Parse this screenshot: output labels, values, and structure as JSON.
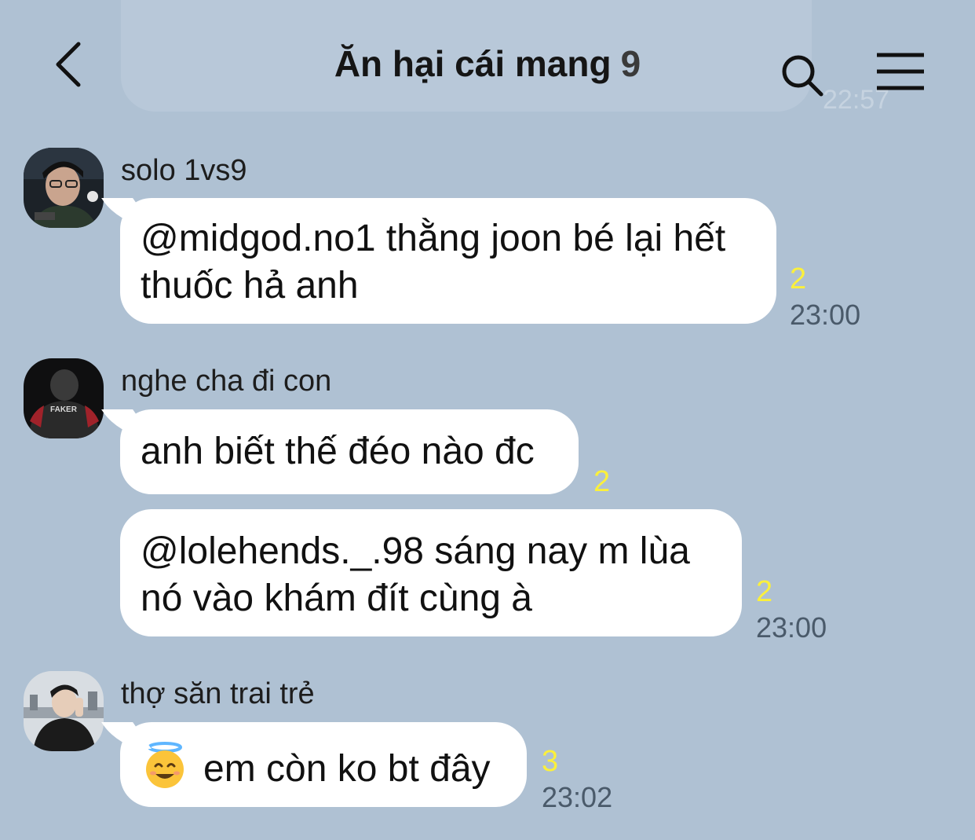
{
  "header": {
    "title": "Ăn hại cái mang",
    "member_count": "9",
    "back_icon": "chevron-left-icon",
    "search_icon": "search-icon",
    "menu_icon": "hamburger-menu-icon"
  },
  "previous_message_time": "22:57",
  "messages": [
    {
      "sender": "solo 1vs9",
      "bubbles": [
        {
          "lines": [
            "@midgod.no1 thằng joon bé lại hết",
            "thuốc hả anh"
          ],
          "read_count": "2",
          "time": "23:00"
        }
      ]
    },
    {
      "sender": "nghe cha đi con",
      "avatar_text": "FAKER",
      "bubbles": [
        {
          "lines": [
            "anh biết thế đéo nào đc"
          ],
          "read_count": "2",
          "time": ""
        },
        {
          "lines": [
            "@lolehends._.98 sáng nay m lùa",
            "nó vào khám đít cùng à"
          ],
          "read_count": "2",
          "time": "23:00"
        }
      ]
    },
    {
      "sender": "thợ săn trai trẻ",
      "bubbles": [
        {
          "emoji": "smiling-face-with-halo",
          "lines": [
            "em còn ko bt đây"
          ],
          "read_count": "3",
          "time": "23:02"
        }
      ]
    }
  ],
  "colors": {
    "background": "#afc1d3",
    "bubble": "#ffffff",
    "read_count": "#fbf03c",
    "timestamp": "#4a5a6a"
  }
}
